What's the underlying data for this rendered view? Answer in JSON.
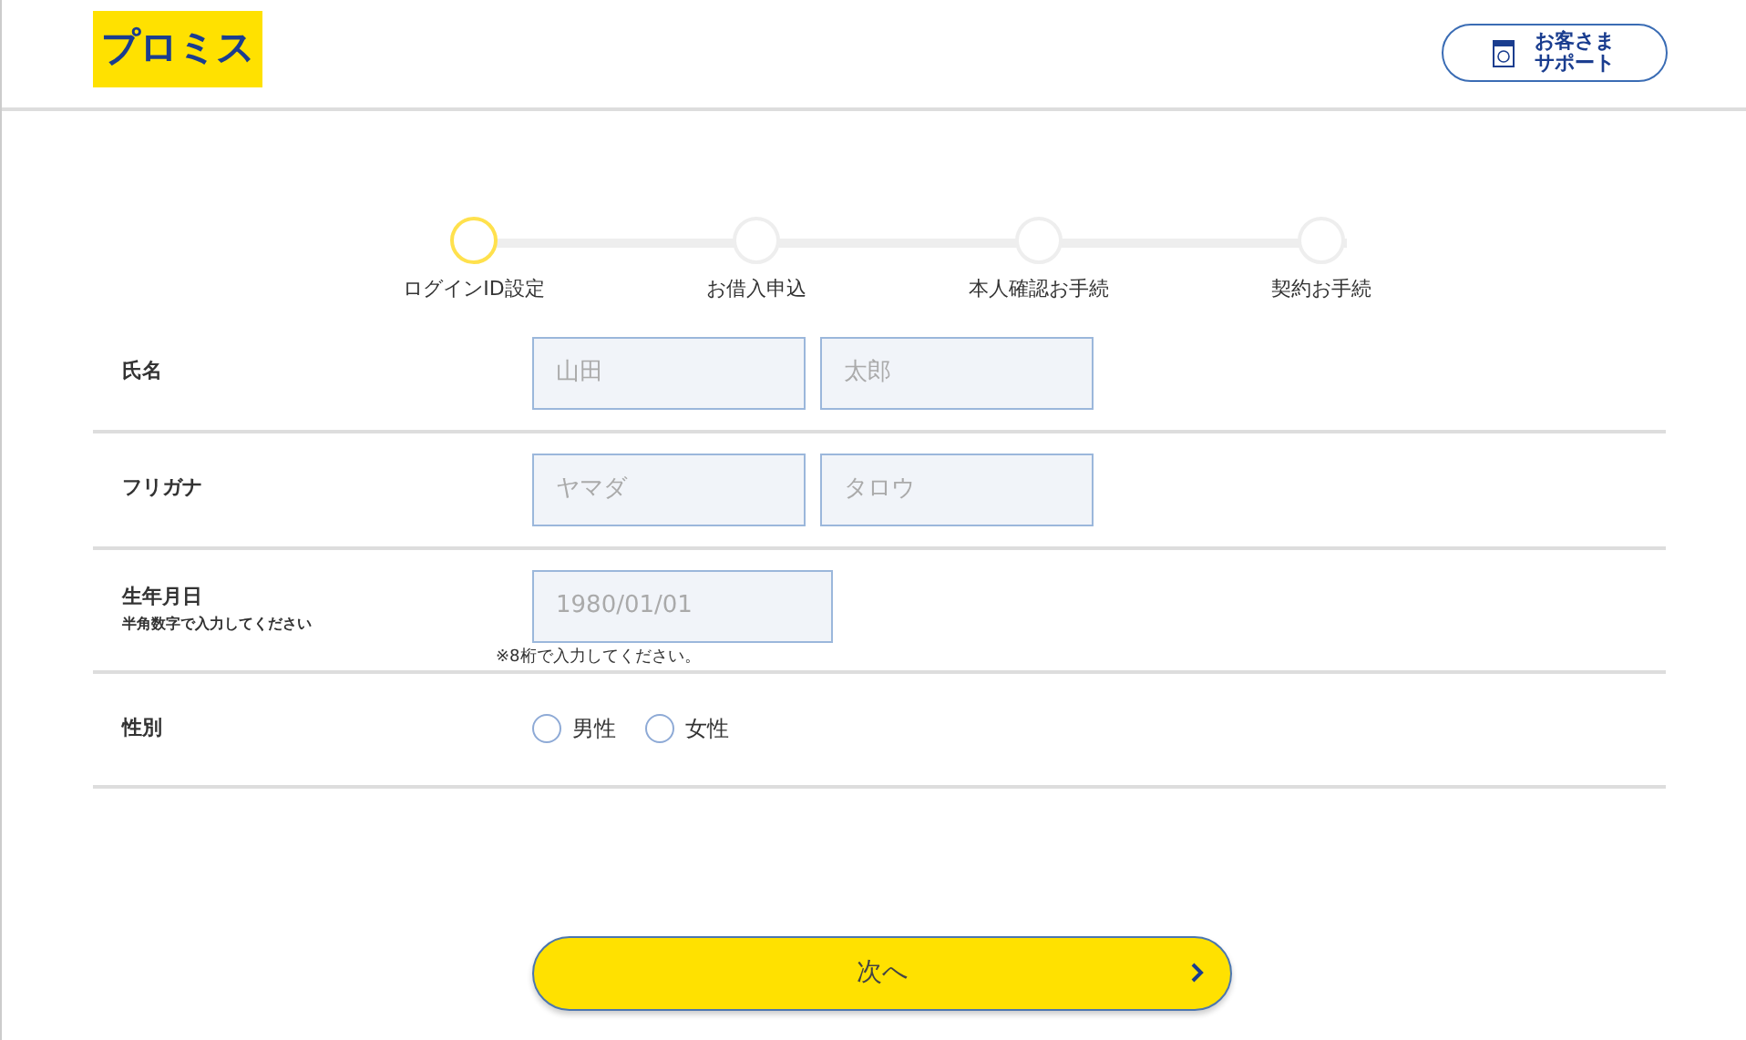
{
  "header": {
    "logo": "プロミス",
    "support_button": "お客さまサポート"
  },
  "steps": [
    {
      "label": "ログインID設定",
      "selected": true
    },
    {
      "label": "お借入申込",
      "selected": false
    },
    {
      "label": "本人確認お手続",
      "selected": false
    },
    {
      "label": "契約お手続",
      "selected": false
    }
  ],
  "form": [
    {
      "kind": "pair",
      "label": "氏名",
      "fields": [
        {
          "placeholder": "山田"
        },
        {
          "placeholder": "太郎"
        }
      ]
    },
    {
      "kind": "pair",
      "label": "フリガナ",
      "fields": [
        {
          "placeholder": "ヤマダ"
        },
        {
          "placeholder": "タロウ"
        }
      ]
    },
    {
      "kind": "date",
      "label": "生年月日",
      "sublabel": "半角数字で入力してください",
      "fields": [
        {
          "placeholder": "1980/01/01"
        }
      ],
      "note": "※8桁で入力してください。"
    },
    {
      "kind": "radio",
      "label": "性別",
      "options": [
        {
          "label": "男性",
          "selected": false
        },
        {
          "label": "女性",
          "selected": false
        }
      ]
    }
  ],
  "next_button": "次へ"
}
